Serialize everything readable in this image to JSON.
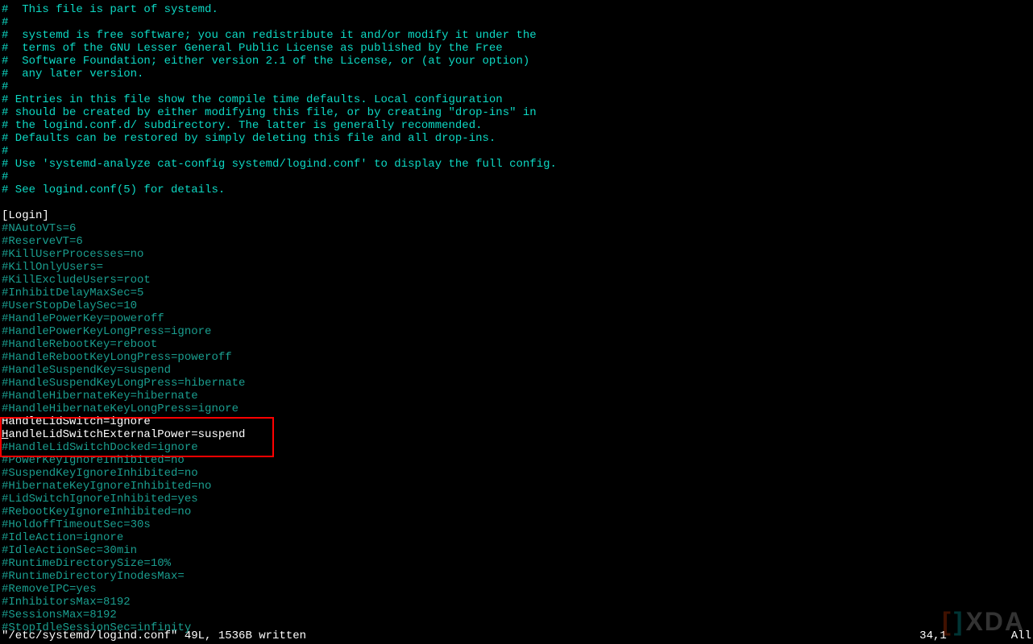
{
  "lines": [
    {
      "text": "#  This file is part of systemd.",
      "cls": "comment"
    },
    {
      "text": "#",
      "cls": "comment"
    },
    {
      "text": "#  systemd is free software; you can redistribute it and/or modify it under the",
      "cls": "comment"
    },
    {
      "text": "#  terms of the GNU Lesser General Public License as published by the Free",
      "cls": "comment"
    },
    {
      "text": "#  Software Foundation; either version 2.1 of the License, or (at your option)",
      "cls": "comment"
    },
    {
      "text": "#  any later version.",
      "cls": "comment"
    },
    {
      "text": "#",
      "cls": "comment"
    },
    {
      "text": "# Entries in this file show the compile time defaults. Local configuration",
      "cls": "comment"
    },
    {
      "text": "# should be created by either modifying this file, or by creating \"drop-ins\" in",
      "cls": "comment"
    },
    {
      "text": "# the logind.conf.d/ subdirectory. The latter is generally recommended.",
      "cls": "comment"
    },
    {
      "text": "# Defaults can be restored by simply deleting this file and all drop-ins.",
      "cls": "comment"
    },
    {
      "text": "#",
      "cls": "comment"
    },
    {
      "text": "# Use 'systemd-analyze cat-config systemd/logind.conf' to display the full config.",
      "cls": "comment"
    },
    {
      "text": "#",
      "cls": "comment"
    },
    {
      "text": "# See logind.conf(5) for details.",
      "cls": "comment"
    },
    {
      "text": "",
      "cls": "comment"
    },
    {
      "text": "[Login]",
      "cls": "section-header"
    },
    {
      "text": "#NAutoVTs=6",
      "cls": "config"
    },
    {
      "text": "#ReserveVT=6",
      "cls": "config"
    },
    {
      "text": "#KillUserProcesses=no",
      "cls": "config"
    },
    {
      "text": "#KillOnlyUsers=",
      "cls": "config"
    },
    {
      "text": "#KillExcludeUsers=root",
      "cls": "config"
    },
    {
      "text": "#InhibitDelayMaxSec=5",
      "cls": "config"
    },
    {
      "text": "#UserStopDelaySec=10",
      "cls": "config"
    },
    {
      "text": "#HandlePowerKey=poweroff",
      "cls": "config"
    },
    {
      "text": "#HandlePowerKeyLongPress=ignore",
      "cls": "config"
    },
    {
      "text": "#HandleRebootKey=reboot",
      "cls": "config"
    },
    {
      "text": "#HandleRebootKeyLongPress=poweroff",
      "cls": "config"
    },
    {
      "text": "#HandleSuspendKey=suspend",
      "cls": "config"
    },
    {
      "text": "#HandleSuspendKeyLongPress=hibernate",
      "cls": "config"
    },
    {
      "text": "#HandleHibernateKey=hibernate",
      "cls": "config"
    },
    {
      "text": "#HandleHibernateKeyLongPress=ignore",
      "cls": "config"
    },
    {
      "text": "HandleLidSwitch=ignore",
      "cls": "uncommented"
    },
    {
      "text": "HandleLidSwitchExternalPower=suspend",
      "cls": "uncommented",
      "cursor": true
    },
    {
      "text": "#HandleLidSwitchDocked=ignore",
      "cls": "config"
    },
    {
      "text": "#PowerKeyIgnoreInhibited=no",
      "cls": "config"
    },
    {
      "text": "#SuspendKeyIgnoreInhibited=no",
      "cls": "config"
    },
    {
      "text": "#HibernateKeyIgnoreInhibited=no",
      "cls": "config"
    },
    {
      "text": "#LidSwitchIgnoreInhibited=yes",
      "cls": "config"
    },
    {
      "text": "#RebootKeyIgnoreInhibited=no",
      "cls": "config"
    },
    {
      "text": "#HoldoffTimeoutSec=30s",
      "cls": "config"
    },
    {
      "text": "#IdleAction=ignore",
      "cls": "config"
    },
    {
      "text": "#IdleActionSec=30min",
      "cls": "config"
    },
    {
      "text": "#RuntimeDirectorySize=10%",
      "cls": "config"
    },
    {
      "text": "#RuntimeDirectoryInodesMax=",
      "cls": "config"
    },
    {
      "text": "#RemoveIPC=yes",
      "cls": "config"
    },
    {
      "text": "#InhibitorsMax=8192",
      "cls": "config"
    },
    {
      "text": "#SessionsMax=8192",
      "cls": "config"
    },
    {
      "text": "#StopIdleSessionSec=infinity",
      "cls": "config"
    }
  ],
  "status": {
    "left": "\"/etc/systemd/logind.conf\" 49L, 1536B written",
    "position": "34,1",
    "scroll": "All"
  },
  "watermark": {
    "bracket_left": "[",
    "bracket_right": "]",
    "text": "XDA"
  }
}
